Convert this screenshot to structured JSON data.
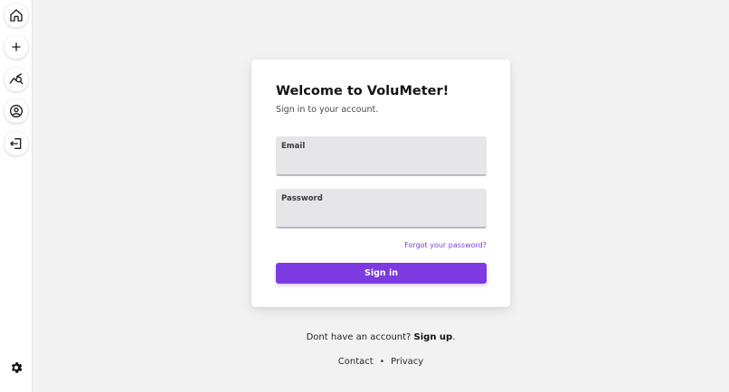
{
  "sidebar": {
    "items": [
      {
        "icon": "home-icon"
      },
      {
        "icon": "plus-icon"
      },
      {
        "icon": "analytics-icon"
      },
      {
        "icon": "user-circle-icon"
      },
      {
        "icon": "logout-icon"
      }
    ],
    "settings_icon": "gear-icon"
  },
  "login": {
    "title": "Welcome to VoluMeter!",
    "subtitle": "Sign in to your account.",
    "email_label": "Email",
    "email_value": "",
    "password_label": "Password",
    "password_value": "",
    "forgot_link": "Forgot your password?",
    "submit_label": "Sign in"
  },
  "signup": {
    "prompt": "Dont have an account? ",
    "link": "Sign up",
    "suffix": "."
  },
  "footer": {
    "contact": "Contact",
    "separator": "•",
    "privacy": "Privacy"
  },
  "colors": {
    "accent": "#7c3ae0",
    "background": "#f2f2f3",
    "field_bg": "#e6e6e9"
  }
}
